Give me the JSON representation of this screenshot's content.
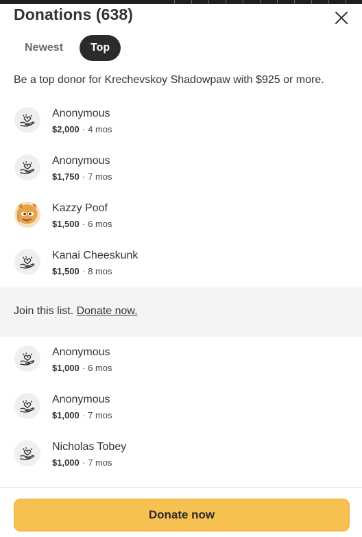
{
  "header": {
    "title": "Donations (638)"
  },
  "tabs": [
    {
      "label": "Newest",
      "active": false
    },
    {
      "label": "Top",
      "active": true
    }
  ],
  "intro": "Be a top donor for Krechevskoy Shadowpaw with $925 or more.",
  "donors_top": [
    {
      "name": "Anonymous",
      "amount": "$2,000",
      "time": "4 mos",
      "avatar": "heart-hand-icon"
    },
    {
      "name": "Anonymous",
      "amount": "$1,750",
      "time": "7 mos",
      "avatar": "heart-hand-icon"
    },
    {
      "name": "Kazzy Poof",
      "amount": "$1,500",
      "time": "6 mos",
      "avatar": "profile-photo"
    },
    {
      "name": "Kanai Cheeskunk",
      "amount": "$1,500",
      "time": "8 mos",
      "avatar": "heart-hand-icon"
    }
  ],
  "join": {
    "text": "Join this list.",
    "link": "Donate now."
  },
  "donors_more": [
    {
      "name": "Anonymous",
      "amount": "$1,000",
      "time": "6 mos",
      "avatar": "heart-hand-icon"
    },
    {
      "name": "Anonymous",
      "amount": "$1,000",
      "time": "7 mos",
      "avatar": "heart-hand-icon"
    },
    {
      "name": "Nicholas Tobey",
      "amount": "$1,000",
      "time": "7 mos",
      "avatar": "heart-hand-icon"
    }
  ],
  "separator": "·",
  "footer": {
    "button_label": "Donate now"
  },
  "colors": {
    "accent": "#f7c152",
    "active_tab": "#2b2b2b",
    "join_bar": "#f4f4f4"
  }
}
